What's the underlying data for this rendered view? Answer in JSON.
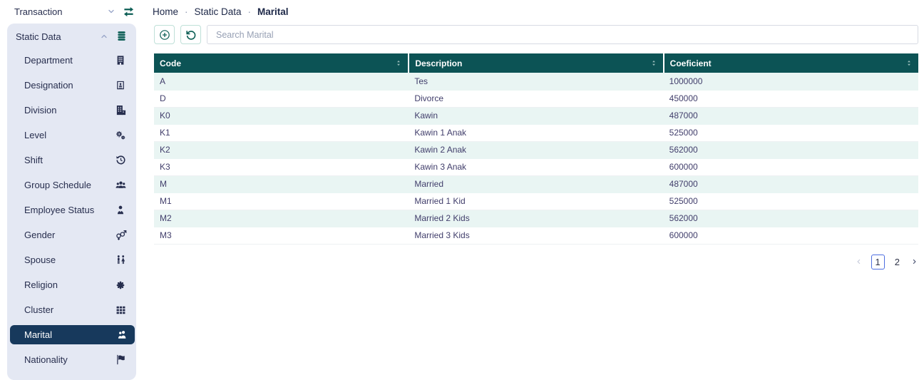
{
  "sidebar": {
    "transaction": {
      "label": "Transaction",
      "icon": "exchange-icon"
    },
    "static_data": {
      "label": "Static Data",
      "icon": "database-icon",
      "items": [
        {
          "label": "Department",
          "icon": "building-icon"
        },
        {
          "label": "Designation",
          "icon": "id-card-icon"
        },
        {
          "label": "Division",
          "icon": "building-annex-icon"
        },
        {
          "label": "Level",
          "icon": "cogs-icon"
        },
        {
          "label": "Shift",
          "icon": "history-icon"
        },
        {
          "label": "Group Schedule",
          "icon": "users-icon"
        },
        {
          "label": "Employee Status",
          "icon": "user-tie-icon"
        },
        {
          "label": "Gender",
          "icon": "venus-mars-icon"
        },
        {
          "label": "Spouse",
          "icon": "restroom-icon"
        },
        {
          "label": "Religion",
          "icon": "rosette-icon"
        },
        {
          "label": "Cluster",
          "icon": "grid-icon"
        },
        {
          "label": "Marital",
          "icon": "people-icon",
          "active": true
        },
        {
          "label": "Nationality",
          "icon": "flag-icon"
        }
      ]
    }
  },
  "breadcrumb": {
    "items": [
      "Home",
      "Static Data",
      "Marital"
    ],
    "separator": "·"
  },
  "toolbar": {
    "add_icon": "plus-circle-icon",
    "refresh_icon": "undo-icon",
    "search_placeholder": "Search Marital",
    "search_value": ""
  },
  "table": {
    "columns": [
      {
        "label": "Code"
      },
      {
        "label": "Description"
      },
      {
        "label": "Coeficient"
      }
    ],
    "rows": [
      {
        "code": "A",
        "description": "Tes",
        "coeficient": "1000000"
      },
      {
        "code": "D",
        "description": "Divorce",
        "coeficient": "450000"
      },
      {
        "code": "K0",
        "description": "Kawin",
        "coeficient": "487000"
      },
      {
        "code": "K1",
        "description": "Kawin 1 Anak",
        "coeficient": "525000"
      },
      {
        "code": "K2",
        "description": "Kawin 2 Anak",
        "coeficient": "562000"
      },
      {
        "code": "K3",
        "description": "Kawin 3 Anak",
        "coeficient": "600000"
      },
      {
        "code": "M",
        "description": "Married",
        "coeficient": "487000"
      },
      {
        "code": "M1",
        "description": "Married 1 Kid",
        "coeficient": "525000"
      },
      {
        "code": "M2",
        "description": "Married 2 Kids",
        "coeficient": "562000"
      },
      {
        "code": "M3",
        "description": "Married 3 Kids",
        "coeficient": "600000"
      }
    ]
  },
  "pagination": {
    "pages": [
      "1",
      "2"
    ],
    "active_page": "1"
  },
  "colors": {
    "header_bg": "#0c5355",
    "accent_teal": "#0c5e55",
    "active_item_bg": "#17395c",
    "sidebar_panel_bg": "#e4e8f3",
    "row_stripe": "#e9f5f3",
    "active_page_border": "#4d6ee0"
  }
}
